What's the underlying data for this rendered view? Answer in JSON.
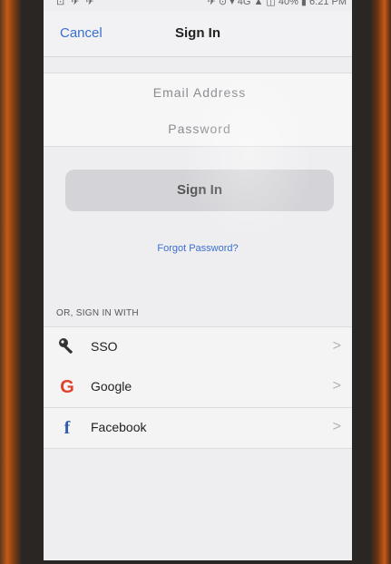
{
  "status_bar": {
    "left_icons": "⊡ ✈ ✈",
    "right_text": "✈ ⊙ ▾ 4G ▲ ◫ 40% ▮ 6:21 PM"
  },
  "navbar": {
    "cancel_label": "Cancel",
    "title": "Sign In"
  },
  "form": {
    "email_placeholder": "Email Address",
    "email_value": "",
    "password_placeholder": "Password",
    "password_value": ""
  },
  "signin_button": {
    "label": "Sign In"
  },
  "forgot_password": {
    "label": "Forgot Password?"
  },
  "alternatives": {
    "section_label": "OR, SIGN IN WITH",
    "items": [
      {
        "label": "SSO",
        "icon": "key-icon"
      },
      {
        "label": "Google",
        "icon": "google-icon"
      },
      {
        "label": "Facebook",
        "icon": "facebook-icon"
      }
    ],
    "chevron": ">"
  },
  "colors": {
    "link_blue": "#3b6fd0",
    "google_red": "#e0412a",
    "facebook_blue": "#2f5bb0",
    "button_gray": "#d4d4d8"
  }
}
